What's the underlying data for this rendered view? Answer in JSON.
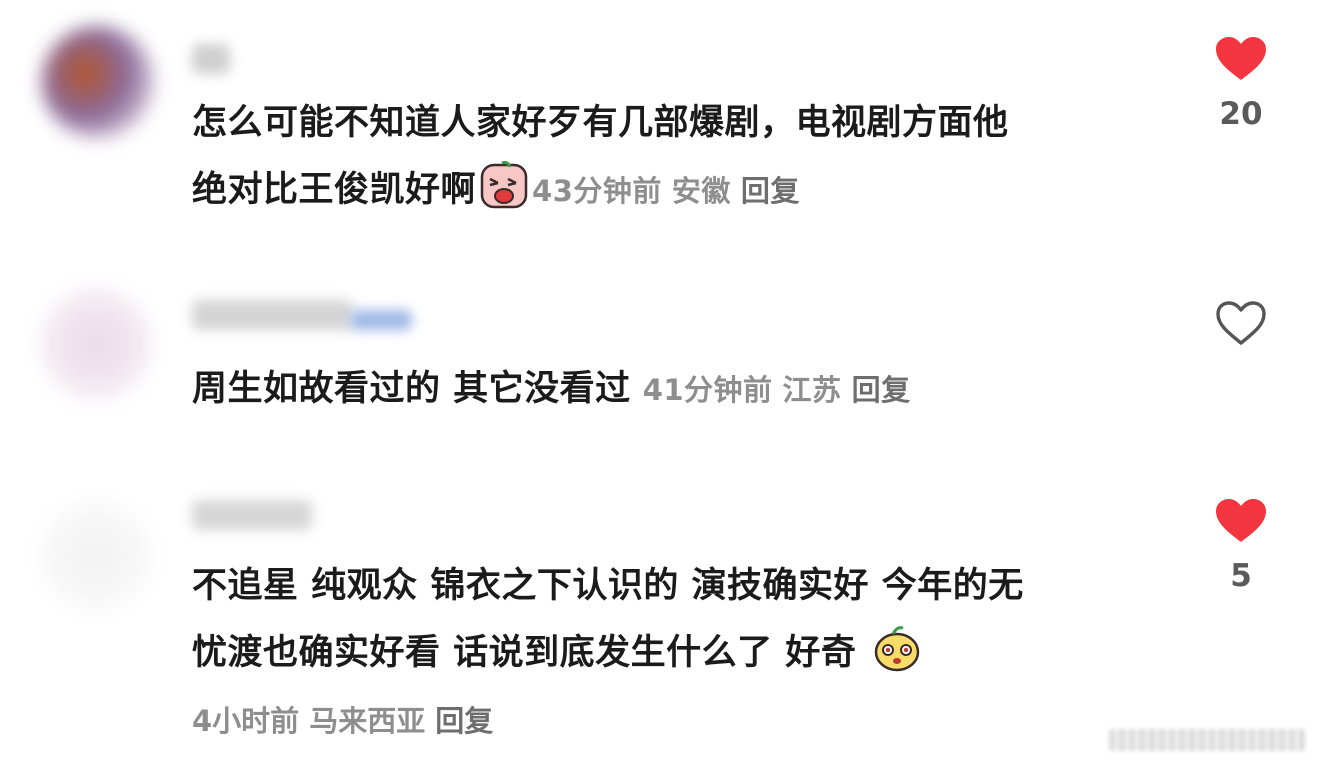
{
  "comments": [
    {
      "text_line1": "怎么可能不知道人家好歹有几部爆剧，电视剧方面他",
      "text_line2": "绝对比王俊凯好啊",
      "emoji": "crying-face-emoji",
      "time": "43分钟前",
      "location": "安徽",
      "reply_label": "回复",
      "like_count": "20",
      "liked": true
    },
    {
      "text_line1": "周生如故看过的 其它没看过",
      "time": "41分钟前",
      "location": "江苏",
      "reply_label": "回复",
      "like_count": "",
      "liked": false
    },
    {
      "text_line1": "不追星 纯观众 锦衣之下认识的 演技确实好 今年的无",
      "text_line2": "忧渡也确实好看 话说到底发生什么了 好奇",
      "emoji": "curious-face-emoji",
      "time": "4小时前",
      "location": "马来西亚",
      "reply_label": "回复",
      "like_count": "5",
      "liked": true
    }
  ],
  "colors": {
    "heart_liked": "#f2353f",
    "heart_outline": "#555555",
    "meta_gray": "#8e8e8e"
  }
}
